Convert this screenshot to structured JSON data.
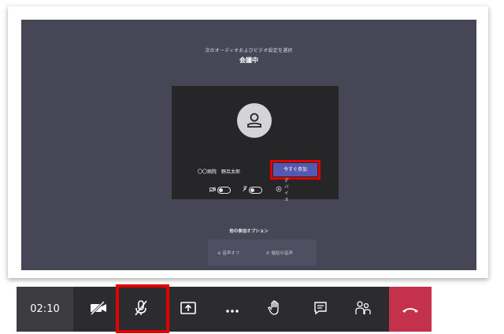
{
  "prejoin": {
    "instruction": "次のオーディオおよびビデオ設定を選択",
    "title": "会議中",
    "user_name": "〇〇病院　野呂太郎",
    "join_label": "今すぐ参加",
    "device_label": "デバイス",
    "other_options_label": "他の参加オプション",
    "audio_off_label": "音声オフ",
    "phone_audio_label": "電話の音声"
  },
  "toolbar": {
    "timer": "02:10"
  },
  "colors": {
    "stage_bg": "#464657",
    "card_bg": "#262628",
    "join_button": "#5558af",
    "toolbar_bg": "#2b2b30",
    "hangup": "#c4314b",
    "highlight": "#e00000"
  },
  "icons": [
    "avatar-person-icon",
    "camera-off-icon",
    "mic-off-icon",
    "device-settings-icon",
    "audio-off-icon",
    "phone-icon",
    "share-screen-icon",
    "more-options-icon",
    "raise-hand-icon",
    "chat-icon",
    "participants-icon",
    "hang-up-icon"
  ]
}
